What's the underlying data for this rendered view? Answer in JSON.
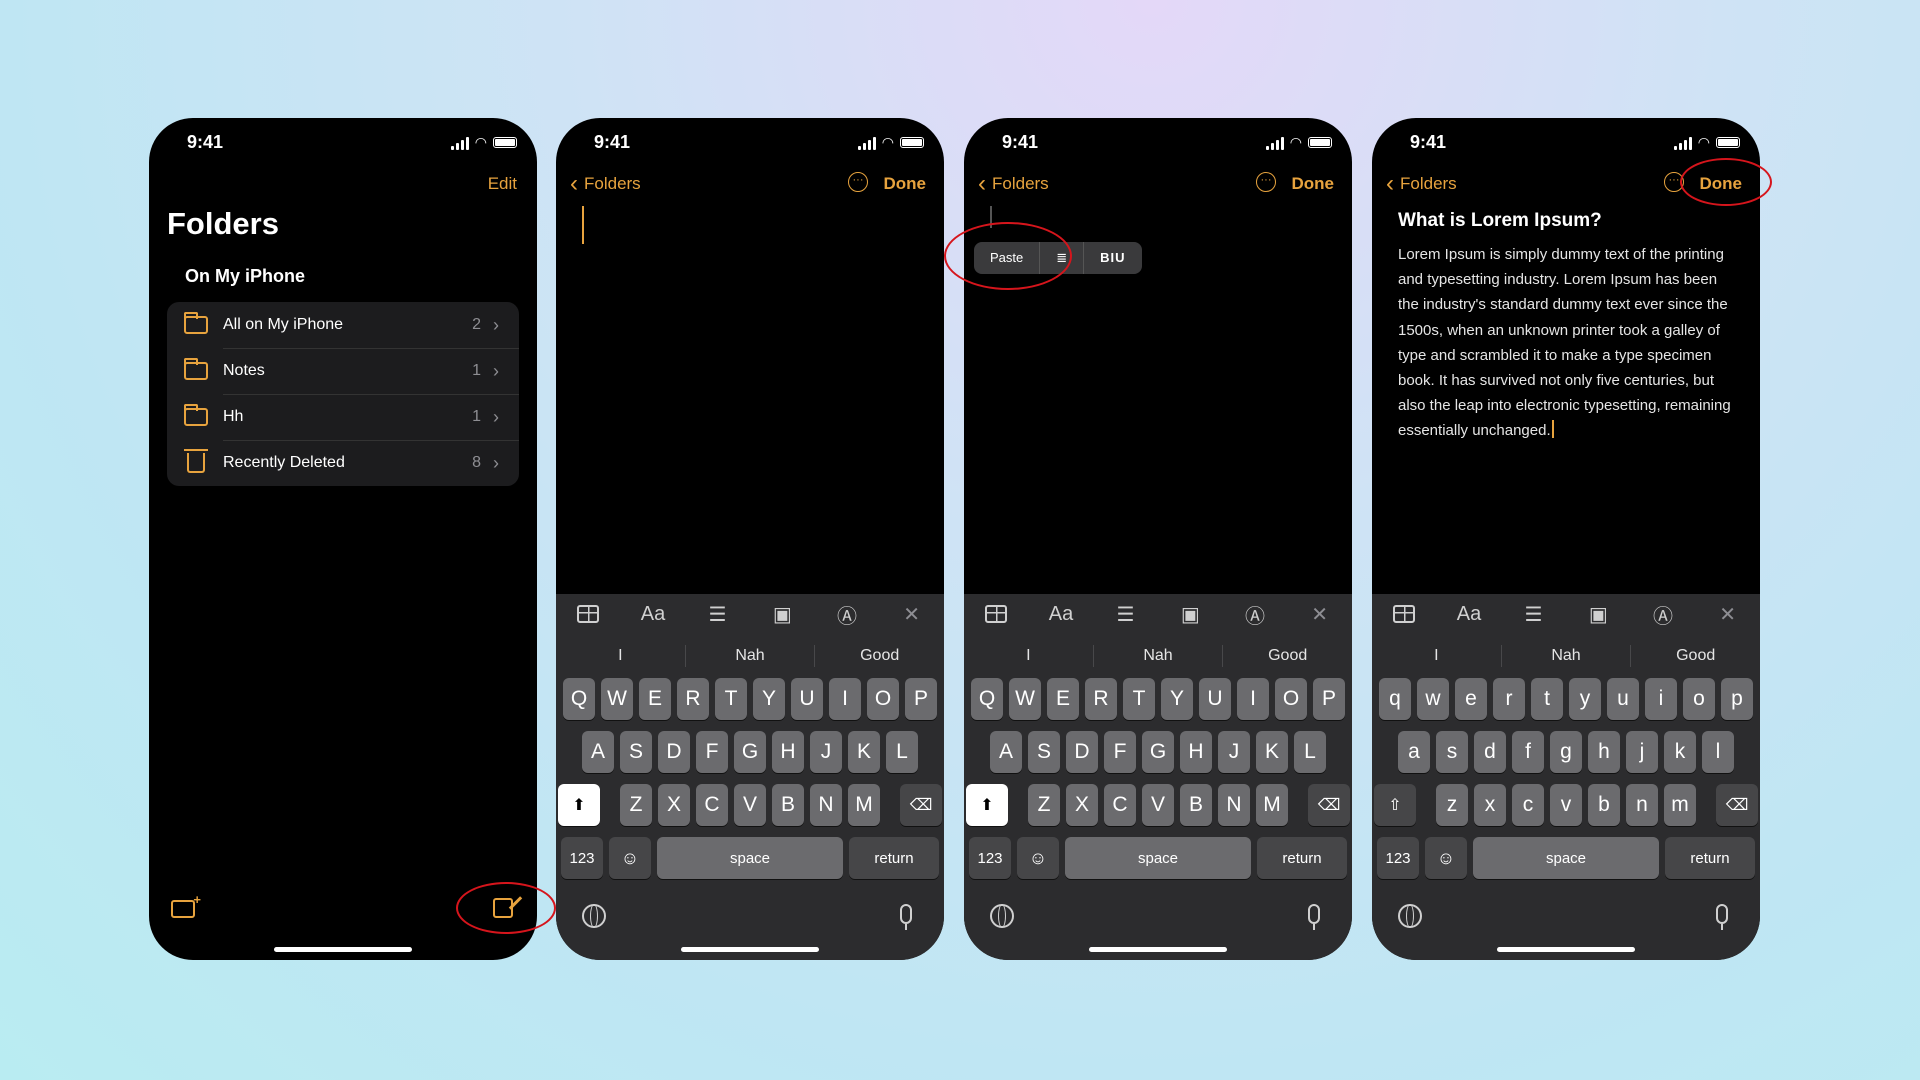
{
  "status": {
    "time": "9:41"
  },
  "screen1": {
    "edit_label": "Edit",
    "title": "Folders",
    "section": "On My iPhone",
    "folders": [
      {
        "name": "All on My iPhone",
        "count": "2",
        "icon": "folder-icon"
      },
      {
        "name": "Notes",
        "count": "1",
        "icon": "folder-icon"
      },
      {
        "name": "Hh",
        "count": "1",
        "icon": "folder-icon"
      },
      {
        "name": "Recently Deleted",
        "count": "8",
        "icon": "trash-icon"
      }
    ]
  },
  "nav": {
    "back_label": "Folders",
    "done_label": "Done"
  },
  "edit_menu": {
    "paste_label": "Paste",
    "format_label": "BIU"
  },
  "note": {
    "title": "What is Lorem Ipsum?",
    "body": "Lorem Ipsum is simply dummy text of the printing and typesetting industry. Lorem Ipsum has been the industry's standard dummy text ever since the 1500s, when an unknown printer took a galley of type and scrambled it to make a type specimen book. It has survived not only five centuries, but also the leap into electronic typesetting, remaining essentially unchanged."
  },
  "toolbar": {
    "format_label": "Aa"
  },
  "keyboard": {
    "suggestions": [
      "I",
      "Nah",
      "Good"
    ],
    "upper_rows": [
      [
        "Q",
        "W",
        "E",
        "R",
        "T",
        "Y",
        "U",
        "I",
        "O",
        "P"
      ],
      [
        "A",
        "S",
        "D",
        "F",
        "G",
        "H",
        "J",
        "K",
        "L"
      ],
      [
        "Z",
        "X",
        "C",
        "V",
        "B",
        "N",
        "M"
      ]
    ],
    "lower_rows": [
      [
        "q",
        "w",
        "e",
        "r",
        "t",
        "y",
        "u",
        "i",
        "o",
        "p"
      ],
      [
        "a",
        "s",
        "d",
        "f",
        "g",
        "h",
        "j",
        "k",
        "l"
      ],
      [
        "z",
        "x",
        "c",
        "v",
        "b",
        "n",
        "m"
      ]
    ],
    "num_label": "123",
    "space_label": "space",
    "return_label": "return"
  },
  "colors": {
    "accent": "#e7a33e",
    "annotation": "#d6151c"
  }
}
